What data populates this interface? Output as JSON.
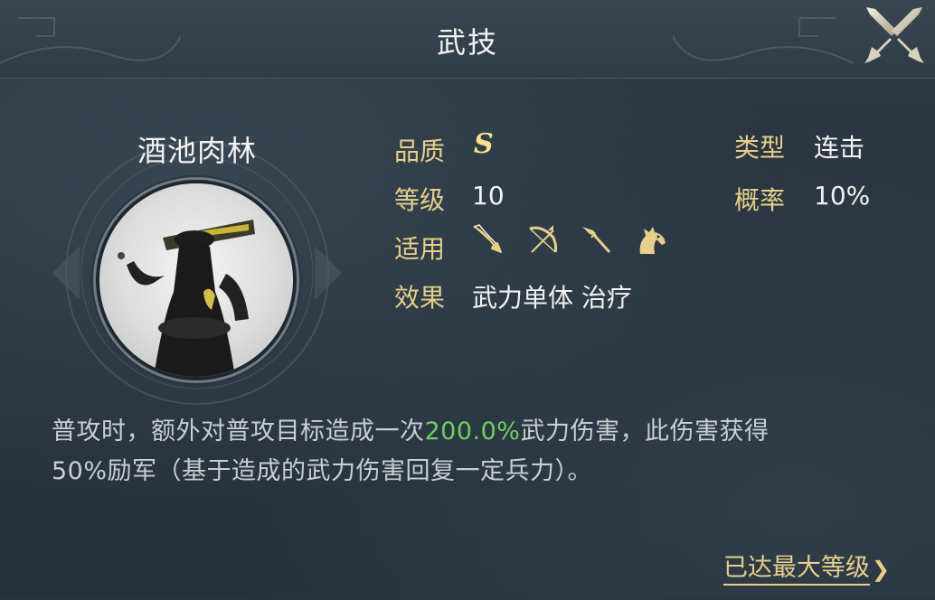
{
  "header": {
    "title": "武技"
  },
  "skill": {
    "name": "酒池肉林",
    "quality_label": "品质",
    "quality_value": "S",
    "level_label": "等级",
    "level_value": "10",
    "applicable_label": "适用",
    "applicable_units": [
      "sword-icon",
      "bow-icon",
      "spear-icon",
      "horse-icon"
    ],
    "effect_label": "效果",
    "effect_value": "武力单体 治疗",
    "type_label": "类型",
    "type_value": "连击",
    "rate_label": "概率",
    "rate_value": "10%"
  },
  "description": {
    "part1": "普攻时，额外对普攻目标造成一次",
    "highlight": "200.0%",
    "part2": "武力伤害，此伤害获得",
    "line2": "50%励军（基于造成的武力伤害回复一定兵力）。"
  },
  "footer": {
    "max_level_label": "已达最大等级",
    "chevron": "❯"
  },
  "colors": {
    "label": "#e6cf8a",
    "highlight": "#6fcf63",
    "grade": "#f7e38c"
  }
}
